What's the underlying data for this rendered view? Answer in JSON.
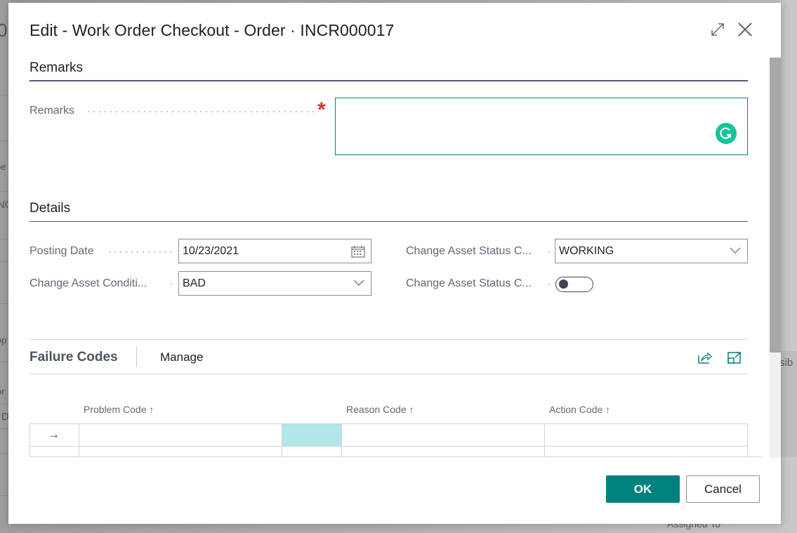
{
  "background": {
    "fragments": [
      "0",
      "pe",
      "NC",
      "op",
      "or",
      "D",
      "sib",
      "Assigned To"
    ]
  },
  "dialog": {
    "title": "Edit - Work Order Checkout - Order · INCR000017",
    "icons": {
      "expand": "expand-icon",
      "close": "close-icon"
    }
  },
  "remarks_section": {
    "title": "Remarks",
    "field_label": "Remarks",
    "required": true,
    "value": ""
  },
  "details_section": {
    "title": "Details",
    "posting_date": {
      "label": "Posting Date",
      "value": "10/23/2021"
    },
    "asset_condition": {
      "label": "Change Asset Conditi...",
      "value": "BAD"
    },
    "asset_status_code": {
      "label": "Change Asset Status C...",
      "value": "WORKING"
    },
    "asset_status_toggle": {
      "label": "Change Asset Status C...",
      "on": false
    }
  },
  "failure_codes": {
    "title": "Failure Codes",
    "manage_label": "Manage",
    "columns": [
      {
        "label": "Problem Code",
        "sort": "↑"
      },
      {
        "label": "Reason Code",
        "sort": "↑"
      },
      {
        "label": "Action Code",
        "sort": "↑"
      }
    ],
    "rows": [
      {
        "marker": "→",
        "problem_code": "",
        "reason_code": "",
        "action_code": ""
      },
      {
        "marker": "",
        "problem_code": "",
        "reason_code": "",
        "action_code": ""
      }
    ]
  },
  "footer": {
    "ok_label": "OK",
    "cancel_label": "Cancel"
  },
  "colors": {
    "accent": "#00807f",
    "required": "#e0352b",
    "selected_cell": "#b2e6ea",
    "grammarly": "#15c39a"
  }
}
